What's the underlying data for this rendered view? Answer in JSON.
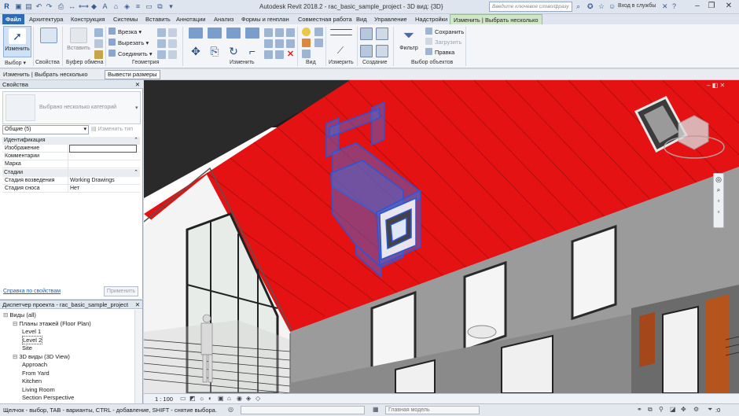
{
  "title": "Autodesk Revit 2018.2 -    rac_basic_sample_project - 3D вид: {3D}",
  "search": {
    "placeholder": "Введите ключевое слово/фразу"
  },
  "login": "Вход в службы",
  "tabs": [
    "Файл",
    "Архитектура",
    "Конструкция",
    "Системы",
    "Вставить",
    "Аннотации",
    "Анализ",
    "Формы и генплан",
    "Совместная работа",
    "Вид",
    "Управление",
    "Надстройки",
    "Изменить | Выбрать несколько"
  ],
  "ribbon": {
    "modify_label": "Изменить",
    "properties_label": "Свойства",
    "paste_label": "Вставить",
    "cut_label": "Вырезать",
    "join_label": "Соединить",
    "cope_label": "Врезка",
    "filter_label": "Фильтр",
    "save_label": "Сохранить",
    "load_label": "Загрузить",
    "edit_label": "Правка",
    "panels": {
      "select": "Выбор",
      "properties": "Свойства",
      "clipboard": "Буфер обмена",
      "geometry": "Геометрия",
      "modify": "Изменить",
      "view": "Вид",
      "measure": "Измерить",
      "create": "Создание",
      "selection": "Выбор объектов"
    }
  },
  "optionsbar": {
    "context": "Изменить | Выбрать несколько",
    "dims_button": "Вывести размеры"
  },
  "properties": {
    "header": "Свойства",
    "type_selector": "Выбрано несколько категорий",
    "filter_value": "Общие (5)",
    "edit_type": "Изменить тип",
    "groups": [
      "Идентификация",
      "Стадии"
    ],
    "rows": [
      {
        "k": "Изображение",
        "v": ""
      },
      {
        "k": "Комментарии",
        "v": ""
      },
      {
        "k": "Марка",
        "v": ""
      },
      {
        "k": "Стадия возведения",
        "v": "Working Drawings"
      },
      {
        "k": "Стадия сноса",
        "v": "Нет"
      }
    ],
    "help_link": "Справка по свойствам",
    "apply": "Применить"
  },
  "browser": {
    "header": "Диспетчер проекта - rac_basic_sample_project",
    "tree": [
      {
        "label": "Виды (all)",
        "level": 0,
        "sign": "−"
      },
      {
        "label": "Планы этажей (Floor Plan)",
        "level": 1,
        "sign": "−"
      },
      {
        "label": "Level 1",
        "level": 2,
        "sign": ""
      },
      {
        "label": "Level 2",
        "level": 2,
        "sign": ""
      },
      {
        "label": "Site",
        "level": 2,
        "sign": ""
      },
      {
        "label": "3D виды (3D View)",
        "level": 1,
        "sign": "−"
      },
      {
        "label": "Approach",
        "level": 2,
        "sign": ""
      },
      {
        "label": "From Yard",
        "level": 2,
        "sign": ""
      },
      {
        "label": "Kitchen",
        "level": 2,
        "sign": ""
      },
      {
        "label": "Living Room",
        "level": 2,
        "sign": ""
      },
      {
        "label": "Section Perspective",
        "level": 2,
        "sign": ""
      }
    ]
  },
  "viewcontrol": {
    "scale": "1 : 100"
  },
  "status": {
    "hint": "Щелчок - выбор, TAB - варианты, CTRL - добавление, SHIFT - снятие выбора.",
    "model": "Главная модель",
    "count": ":0"
  },
  "colors": {
    "roof": "#e01414",
    "selection": "#3f6fe0",
    "accent": "#2d6bb5"
  }
}
